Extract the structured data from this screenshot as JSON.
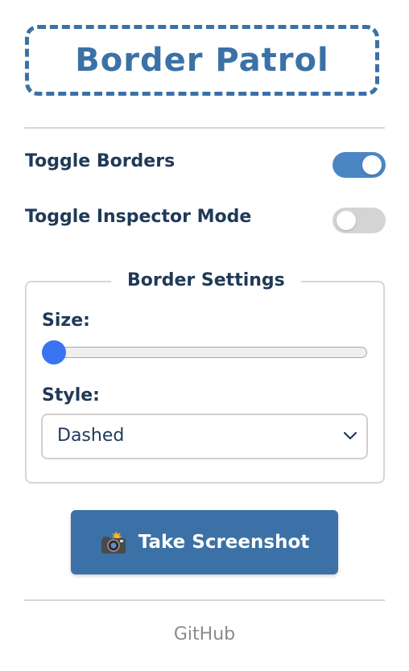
{
  "header": {
    "title": "Border Patrol"
  },
  "toggles": [
    {
      "label": "Toggle Borders",
      "state": "on"
    },
    {
      "label": "Toggle Inspector Mode",
      "state": "off"
    }
  ],
  "settings": {
    "legend": "Border Settings",
    "size_label": "Size:",
    "size_value": 0,
    "style_label": "Style:",
    "style_value": "Dashed"
  },
  "actions": {
    "screenshot_label": "Take Screenshot",
    "screenshot_icon": "camera-flash-icon"
  },
  "footer": {
    "link": "GitHub"
  },
  "colors": {
    "accent": "#3b71a6",
    "toggle_on": "#4a86c2",
    "toggle_off": "#d4d4d4",
    "slider_thumb": "#3a74f0",
    "text": "#1f3a57",
    "footer_text": "#8a8a8a"
  }
}
